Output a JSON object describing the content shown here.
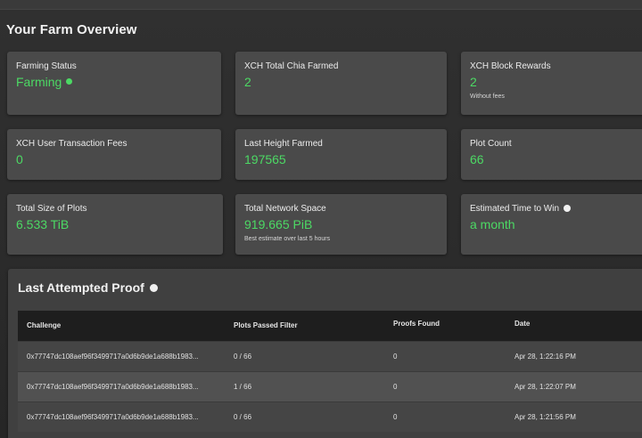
{
  "page": {
    "title": "Your Farm Overview"
  },
  "cards": {
    "farming_status": {
      "title": "Farming Status",
      "value": "Farming"
    },
    "total_farmed": {
      "title": "XCH Total Chia Farmed",
      "value": "2"
    },
    "block_rewards": {
      "title": "XCH Block Rewards",
      "value": "2",
      "sub": "Without fees"
    },
    "tx_fees": {
      "title": "XCH User Transaction Fees",
      "value": "0"
    },
    "last_height": {
      "title": "Last Height Farmed",
      "value": "197565"
    },
    "plot_count": {
      "title": "Plot Count",
      "value": "66"
    },
    "plot_size": {
      "title": "Total Size of Plots",
      "value": "6.533 TiB"
    },
    "network_space": {
      "title": "Total Network Space",
      "value": "919.665 PiB",
      "sub": "Best estimate over last 5 hours"
    },
    "time_to_win": {
      "title": "Estimated Time to Win",
      "value": "a month"
    }
  },
  "proofs": {
    "title": "Last Attempted Proof",
    "columns": {
      "challenge": "Challenge",
      "plots_passed": "Plots Passed Filter",
      "proofs_found": "Proofs Found",
      "date": "Date"
    },
    "rows": [
      {
        "challenge": "0x77747dc108aef96f3499717a0d6b9de1a688b1983...",
        "plots_passed": "0 / 66",
        "proofs_found": "0",
        "date": "Apr 28, 1:22:16 PM"
      },
      {
        "challenge": "0x77747dc108aef96f3499717a0d6b9de1a688b1983...",
        "plots_passed": "1 / 66",
        "proofs_found": "0",
        "date": "Apr 28, 1:22:07 PM"
      },
      {
        "challenge": "0x77747dc108aef96f3499717a0d6b9de1a688b1983...",
        "plots_passed": "0 / 66",
        "proofs_found": "0",
        "date": "Apr 28, 1:21:56 PM"
      }
    ]
  },
  "colors": {
    "accent_green": "#4cd964",
    "card_background": "#4a4a4a",
    "table_header": "#1e1e1e"
  },
  "icons": {
    "status": "status-dot-icon",
    "help": "help-circle-icon"
  }
}
